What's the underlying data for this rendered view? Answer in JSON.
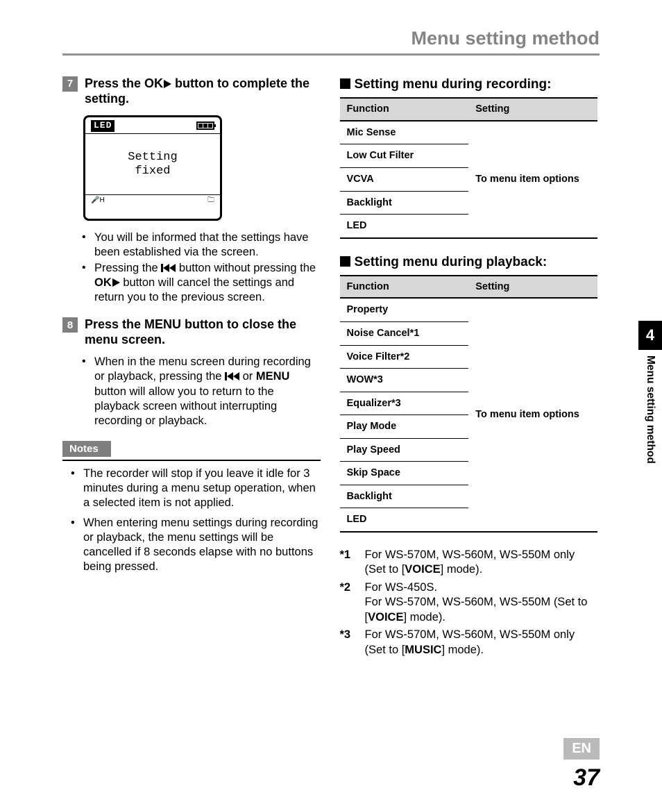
{
  "header_title": "Menu setting method",
  "step7": {
    "num": "7",
    "text_before": "Press the ",
    "ok": "OK",
    "text_after": " button to complete the setting."
  },
  "lcd": {
    "label": "LED",
    "line1": "Setting",
    "line2": "fixed"
  },
  "step7_bullets": {
    "b1": "You will be informed that the settings have been established via the screen.",
    "b2_a": "Pressing the ",
    "b2_b": " button without pressing the ",
    "b2_ok": "OK",
    "b2_c": " button will cancel the settings and return you to the previous screen."
  },
  "step8": {
    "num": "8",
    "text_a": "Press the ",
    "menu": "MENU",
    "text_b": " button to close the menu screen."
  },
  "step8_bullets": {
    "b1_a": "When in the menu screen during recording or playback, pressing the ",
    "b1_b": " or ",
    "b1_menu": "MENU",
    "b1_c": " button will allow you to return to the playback screen without interrupting recording or playback."
  },
  "notes_header": "Notes",
  "notes": {
    "n1": "The recorder will stop if you leave it idle for 3 minutes during a menu setup operation, when a selected item is not applied.",
    "n2": "When entering menu settings during recording or playback, the menu settings will be cancelled if 8 seconds elapse with no buttons being pressed."
  },
  "sub_recording": "Setting menu during recording:",
  "sub_playback": "Setting menu during playback:",
  "th_function": "Function",
  "th_setting": "Setting",
  "setting_cell": "To menu item options",
  "recording_rows": [
    "Mic Sense",
    "Low Cut Filter",
    "VCVA",
    "Backlight",
    "LED"
  ],
  "playback_rows": [
    "Property",
    "Noise Cancel*1",
    "Voice Filter*2",
    "WOW*3",
    "Equalizer*3",
    "Play Mode",
    "Play Speed",
    "Skip Space",
    "Backlight",
    "LED"
  ],
  "footnotes": {
    "f1": {
      "k": "*1",
      "a": "For WS-570M, WS-560M, WS-550M only (Set to [",
      "b": "VOICE",
      "c": "] mode)."
    },
    "f2": {
      "k": "*2",
      "lines": [
        "For WS-450S.",
        "For WS-570M, WS-560M, WS-550M (Set to [VOICE] mode)."
      ],
      "a": "For WS-450S.",
      "b_a": "For WS-570M, WS-560M, WS-550M (Set to [",
      "b_b": "VOICE",
      "b_c": "] mode)."
    },
    "f3": {
      "k": "*3",
      "a": "For WS-570M, WS-560M, WS-550M only (Set to [",
      "b": "MUSIC",
      "c": "] mode)."
    }
  },
  "chapter_num": "4",
  "side_label": "Menu setting method",
  "lang": "EN",
  "page_number": "37"
}
